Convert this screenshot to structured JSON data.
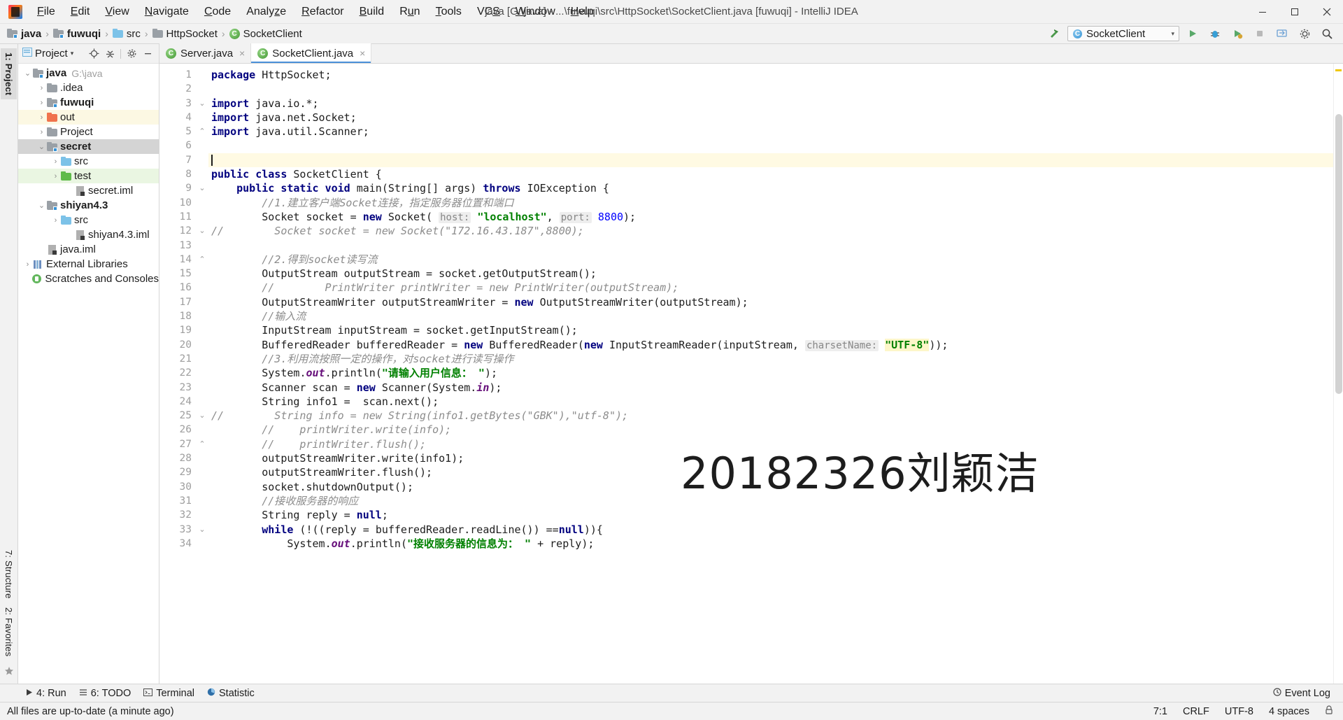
{
  "window": {
    "title": "java [G:\\java] - ...\\fuwuqi\\src\\HttpSocket\\SocketClient.java [fuwuqi] - IntelliJ IDEA",
    "logo_name": "intellij-idea-logo"
  },
  "menubar": {
    "items": [
      {
        "label": "File",
        "mnemonic": "F"
      },
      {
        "label": "Edit",
        "mnemonic": "E"
      },
      {
        "label": "View",
        "mnemonic": "V"
      },
      {
        "label": "Navigate",
        "mnemonic": "N"
      },
      {
        "label": "Code",
        "mnemonic": "C"
      },
      {
        "label": "Analyze",
        "mnemonic": "z"
      },
      {
        "label": "Refactor",
        "mnemonic": "R"
      },
      {
        "label": "Build",
        "mnemonic": "B"
      },
      {
        "label": "Run",
        "mnemonic": "u"
      },
      {
        "label": "Tools",
        "mnemonic": "T"
      },
      {
        "label": "VCS",
        "mnemonic": "S"
      },
      {
        "label": "Window",
        "mnemonic": "W"
      },
      {
        "label": "Help",
        "mnemonic": "H"
      }
    ]
  },
  "window_controls": {
    "minimize": "minimize",
    "maximize": "maximize",
    "close": "close"
  },
  "breadcrumb": {
    "items": [
      {
        "label": "java",
        "icon": "module-folder-icon",
        "bold": true
      },
      {
        "label": "fuwuqi",
        "icon": "module-folder-icon",
        "bold": true
      },
      {
        "label": "src",
        "icon": "source-folder-icon",
        "bold": false
      },
      {
        "label": "HttpSocket",
        "icon": "package-folder-icon",
        "bold": false
      },
      {
        "label": "SocketClient",
        "icon": "java-class-icon",
        "bold": false
      }
    ],
    "separator": "›"
  },
  "toolbar": {
    "build_icon": "hammer-icon",
    "run_config": "SocketClient",
    "run_config_caret": "▾",
    "run_icon": "run-icon",
    "debug_icon": "debug-icon",
    "coverage_icon": "run-with-coverage-icon",
    "stop_icon": "stop-icon",
    "updates_icon": "update-project-icon",
    "settings_icon": "settings-icon",
    "search_icon": "search-everywhere-icon"
  },
  "left_rail": {
    "tabs": [
      {
        "label": "1: Project",
        "active": true
      },
      {
        "label": "7: Structure",
        "active": false
      },
      {
        "label": "2: Favorites",
        "active": false
      }
    ]
  },
  "project_panel": {
    "title": "Project",
    "caret": "▾",
    "icons": [
      "project-view-icon",
      "locate-icon",
      "collapse-all-icon",
      "settings-gear-icon",
      "hide-icon"
    ],
    "tree": [
      {
        "label": "java",
        "sub": "G:\\java",
        "depth": 0,
        "arrow": "⌄",
        "icon": "module-folder",
        "bold": true,
        "state": "normal"
      },
      {
        "label": ".idea",
        "sub": "",
        "depth": 1,
        "arrow": "›",
        "icon": "folder-gray",
        "bold": false,
        "state": "normal"
      },
      {
        "label": "fuwuqi",
        "sub": "",
        "depth": 1,
        "arrow": "›",
        "icon": "module-folder",
        "bold": true,
        "state": "normal"
      },
      {
        "label": "out",
        "sub": "",
        "depth": 1,
        "arrow": "›",
        "icon": "folder-orange",
        "bold": false,
        "state": "yellow"
      },
      {
        "label": "Project",
        "sub": "",
        "depth": 1,
        "arrow": "›",
        "icon": "folder-gray",
        "bold": false,
        "state": "normal"
      },
      {
        "label": "secret",
        "sub": "",
        "depth": 1,
        "arrow": "⌄",
        "icon": "module-folder",
        "bold": true,
        "state": "selected"
      },
      {
        "label": "src",
        "sub": "",
        "depth": 2,
        "arrow": "›",
        "icon": "folder-blue",
        "bold": false,
        "state": "normal"
      },
      {
        "label": "test",
        "sub": "",
        "depth": 2,
        "arrow": "›",
        "icon": "folder-green",
        "bold": false,
        "state": "green"
      },
      {
        "label": "secret.iml",
        "sub": "",
        "depth": 3,
        "arrow": "",
        "icon": "iml-file",
        "bold": false,
        "state": "normal"
      },
      {
        "label": "shiyan4.3",
        "sub": "",
        "depth": 1,
        "arrow": "⌄",
        "icon": "module-folder",
        "bold": true,
        "state": "normal"
      },
      {
        "label": "src",
        "sub": "",
        "depth": 2,
        "arrow": "›",
        "icon": "folder-blue",
        "bold": false,
        "state": "normal"
      },
      {
        "label": "shiyan4.3.iml",
        "sub": "",
        "depth": 3,
        "arrow": "",
        "icon": "iml-file",
        "bold": false,
        "state": "normal"
      },
      {
        "label": "java.iml",
        "sub": "",
        "depth": 1,
        "arrow": "",
        "icon": "iml-file",
        "bold": false,
        "state": "normal"
      },
      {
        "label": "External Libraries",
        "sub": "",
        "depth": 0,
        "arrow": "›",
        "icon": "library-icon",
        "bold": false,
        "state": "normal"
      },
      {
        "label": "Scratches and Consoles",
        "sub": "",
        "depth": 0,
        "arrow": "",
        "icon": "scratch-icon",
        "bold": false,
        "state": "normal"
      }
    ]
  },
  "tabs": [
    {
      "label": "Server.java",
      "icon": "java-class-icon",
      "active": false,
      "close": "×"
    },
    {
      "label": "SocketClient.java",
      "icon": "java-class-icon",
      "active": true,
      "close": "×"
    }
  ],
  "editor": {
    "watermark": "20182326刘颖洁",
    "first_line": 1,
    "lines": [
      {
        "n": 1,
        "gutter_mark": "",
        "fold": "",
        "caret": false
      },
      {
        "n": 2,
        "gutter_mark": "",
        "fold": "",
        "caret": false
      },
      {
        "n": 3,
        "gutter_mark": "",
        "fold": "⌄",
        "caret": false
      },
      {
        "n": 4,
        "gutter_mark": "",
        "fold": "",
        "caret": false
      },
      {
        "n": 5,
        "gutter_mark": "",
        "fold": "⌃",
        "caret": false
      },
      {
        "n": 6,
        "gutter_mark": "",
        "fold": "",
        "caret": false
      },
      {
        "n": 7,
        "gutter_mark": "",
        "fold": "",
        "caret": true
      },
      {
        "n": 8,
        "gutter_mark": "run",
        "fold": "",
        "caret": false
      },
      {
        "n": 9,
        "gutter_mark": "run",
        "fold": "⌄",
        "caret": false
      },
      {
        "n": 10,
        "gutter_mark": "",
        "fold": "",
        "caret": false
      },
      {
        "n": 11,
        "gutter_mark": "",
        "fold": "",
        "caret": false
      },
      {
        "n": 12,
        "gutter_mark": "",
        "fold": "⌄",
        "caret": false
      },
      {
        "n": 13,
        "gutter_mark": "",
        "fold": "",
        "caret": false
      },
      {
        "n": 14,
        "gutter_mark": "",
        "fold": "⌃",
        "caret": false
      },
      {
        "n": 15,
        "gutter_mark": "",
        "fold": "",
        "caret": false
      },
      {
        "n": 16,
        "gutter_mark": "",
        "fold": "",
        "caret": false
      },
      {
        "n": 17,
        "gutter_mark": "",
        "fold": "",
        "caret": false
      },
      {
        "n": 18,
        "gutter_mark": "",
        "fold": "",
        "caret": false
      },
      {
        "n": 19,
        "gutter_mark": "",
        "fold": "",
        "caret": false
      },
      {
        "n": 20,
        "gutter_mark": "",
        "fold": "",
        "caret": false
      },
      {
        "n": 21,
        "gutter_mark": "",
        "fold": "",
        "caret": false
      },
      {
        "n": 22,
        "gutter_mark": "",
        "fold": "",
        "caret": false
      },
      {
        "n": 23,
        "gutter_mark": "",
        "fold": "",
        "caret": false
      },
      {
        "n": 24,
        "gutter_mark": "",
        "fold": "",
        "caret": false
      },
      {
        "n": 25,
        "gutter_mark": "",
        "fold": "⌄",
        "caret": false
      },
      {
        "n": 26,
        "gutter_mark": "",
        "fold": "",
        "caret": false
      },
      {
        "n": 27,
        "gutter_mark": "",
        "fold": "⌃",
        "caret": false
      },
      {
        "n": 28,
        "gutter_mark": "",
        "fold": "",
        "caret": false
      },
      {
        "n": 29,
        "gutter_mark": "",
        "fold": "",
        "caret": false
      },
      {
        "n": 30,
        "gutter_mark": "",
        "fold": "",
        "caret": false
      },
      {
        "n": 31,
        "gutter_mark": "",
        "fold": "",
        "caret": false
      },
      {
        "n": 32,
        "gutter_mark": "",
        "fold": "",
        "caret": false
      },
      {
        "n": 33,
        "gutter_mark": "",
        "fold": "⌄",
        "caret": false
      },
      {
        "n": 34,
        "gutter_mark": "",
        "fold": "",
        "caret": false
      }
    ],
    "source_text": [
      "package HttpSocket;",
      "",
      "import java.io.*;",
      "import java.net.Socket;",
      "import java.util.Scanner;",
      "",
      "",
      "public class SocketClient {",
      "    public static void main(String[] args) throws IOException {",
      "        //1.建立客户端Socket连接，指定服务器位置和端口",
      "        Socket socket = new Socket( host: \"localhost\", port: 8800);",
      "//        Socket socket = new Socket(\"172.16.43.187\",8800);",
      "",
      "        //2.得到socket读写流",
      "        OutputStream outputStream = socket.getOutputStream();",
      "        //        PrintWriter printWriter = new PrintWriter(outputStream);",
      "        OutputStreamWriter outputStreamWriter = new OutputStreamWriter(outputStream);",
      "        //输入流",
      "        InputStream inputStream = socket.getInputStream();",
      "        BufferedReader bufferedReader = new BufferedReader(new InputStreamReader(inputStream, charsetName: \"UTF-8\"));",
      "        //3.利用流按照一定的操作，对socket进行读写操作",
      "        System.out.println(\"请输入用户信息： \");",
      "        Scanner scan = new Scanner(System.in);",
      "        String info1 =  scan.next();",
      "//        String info = new String(info1.getBytes(\"GBK\"),\"utf-8\");",
      "        //    printWriter.write(info);",
      "        //    printWriter.flush();",
      "        outputStreamWriter.write(info1);",
      "        outputStreamWriter.flush();",
      "        socket.shutdownOutput();",
      "        //接收服务器的响应",
      "        String reply = null;",
      "        while (!((reply = bufferedReader.readLine()) ==null)){",
      "            System.out.println(\"接收服务器的信息为： \" + reply);"
    ]
  },
  "bottom_toolwindows": {
    "items": [
      {
        "label": "4: Run",
        "icon": "run-icon"
      },
      {
        "label": "6: TODO",
        "icon": "todo-icon"
      },
      {
        "label": "Terminal",
        "icon": "terminal-icon"
      },
      {
        "label": "Statistic",
        "icon": "statistic-icon"
      }
    ],
    "event_log": {
      "label": "Event Log",
      "icon": "event-log-icon"
    }
  },
  "statusbar": {
    "message": "All files are up-to-date (a minute ago)",
    "position": "7:1",
    "line_separator": "CRLF",
    "encoding": "UTF-8",
    "indent": "4 spaces",
    "lock_icon": "read-only-lock-icon"
  }
}
